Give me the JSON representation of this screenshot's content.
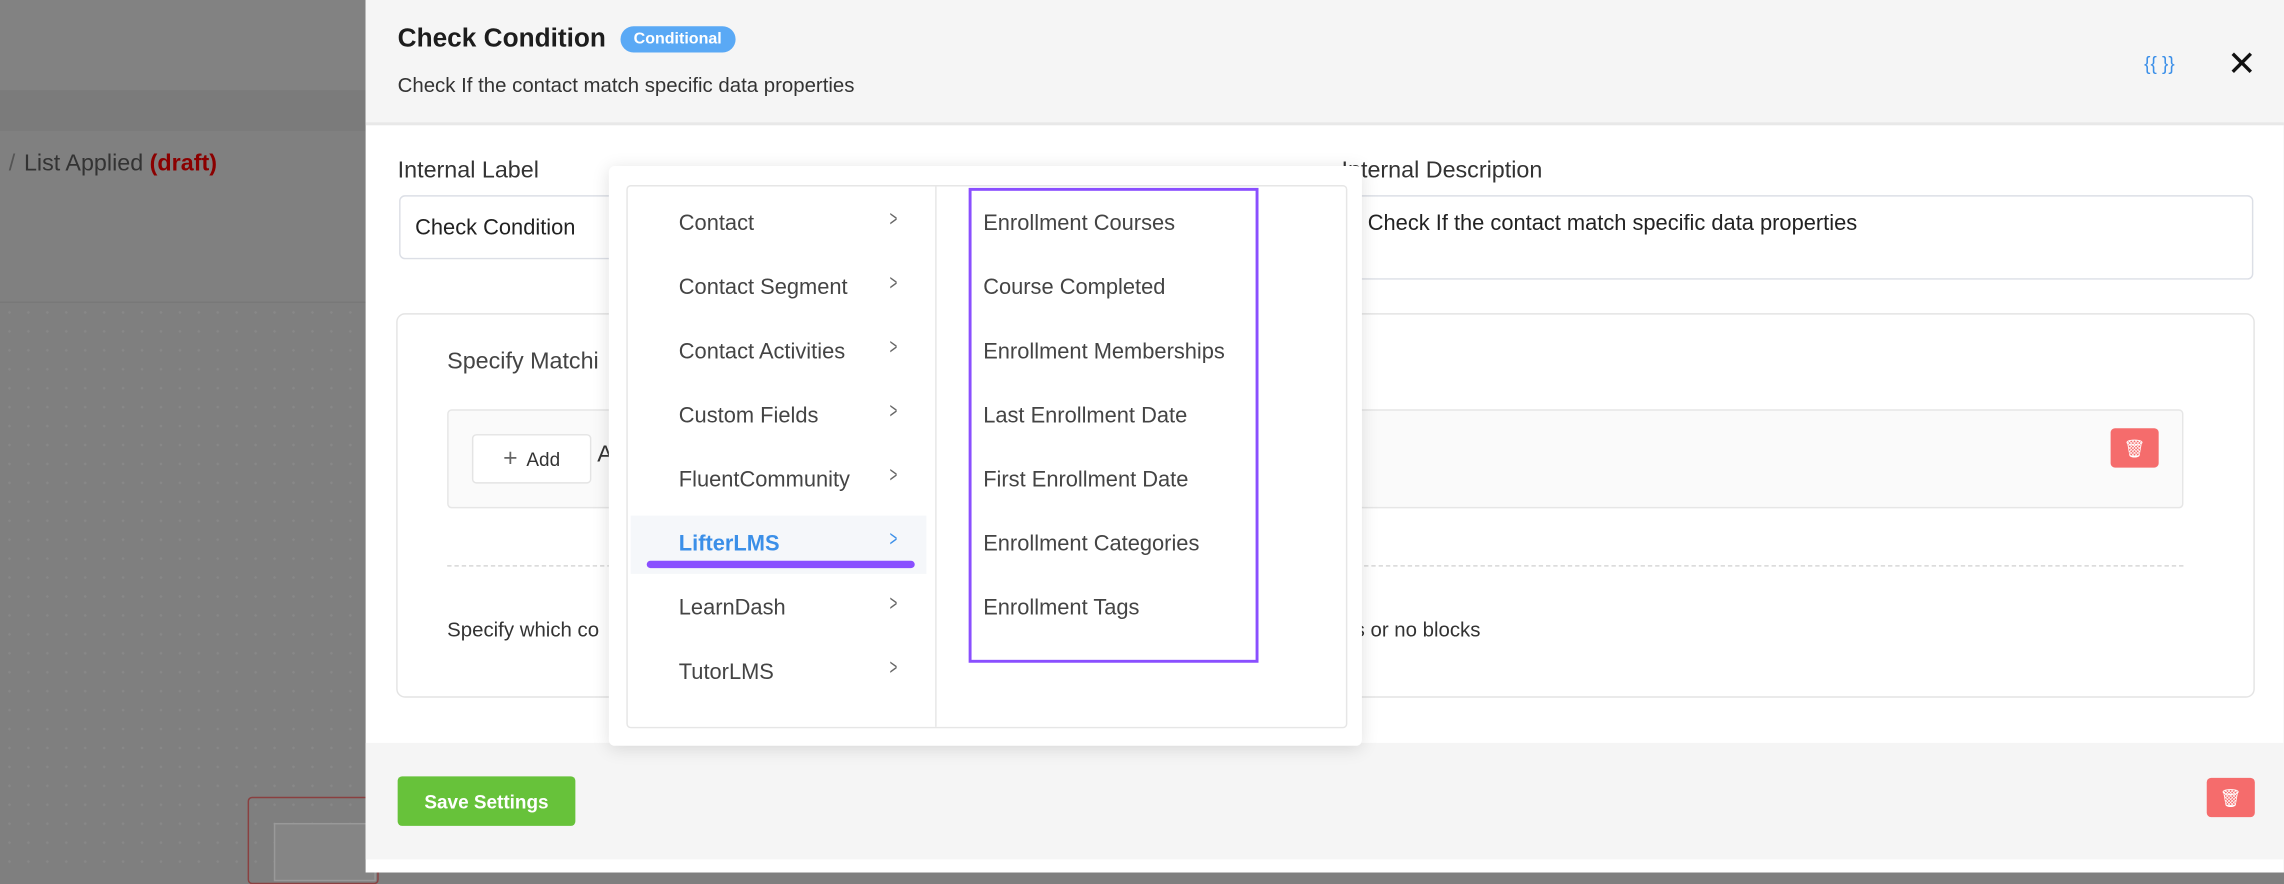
{
  "background": {
    "breadcrumb_sep": "/",
    "breadcrumb_page": "List Applied",
    "breadcrumb_status": "(draft)"
  },
  "header": {
    "title": "Check Condition",
    "badge": "Conditional",
    "subtitle": "Check If the contact match specific data properties",
    "smartcode_icon": "{{ }}",
    "close_icon": "✕"
  },
  "form": {
    "internal_label": "Internal Label",
    "internal_label_value": "Check Condition",
    "internal_description": "Internal Description",
    "internal_description_value": "Check If the contact match specific data properties"
  },
  "card": {
    "title_visible": "Specify Matchi",
    "add_label": "Add",
    "add_after": "A",
    "note_left": "Specify which co",
    "note_right": "ks or no blocks"
  },
  "footer": {
    "save_label": "Save Settings"
  },
  "dropdown": {
    "categories": [
      {
        "label": "Contact"
      },
      {
        "label": "Contact Segment"
      },
      {
        "label": "Contact Activities"
      },
      {
        "label": "Custom Fields"
      },
      {
        "label": "FluentCommunity"
      },
      {
        "label": "LifterLMS",
        "active": true
      },
      {
        "label": "LearnDash"
      },
      {
        "label": "TutorLMS"
      }
    ],
    "options": [
      "Enrollment Courses",
      "Course Completed",
      "Enrollment Memberships",
      "Last Enrollment Date",
      "First Enrollment Date",
      "Enrollment Categories",
      "Enrollment Tags"
    ]
  },
  "colors": {
    "accent": "#3b8fe8",
    "badge": "#5aa9f5",
    "save": "#67c23a",
    "danger": "#f56c6c",
    "highlight": "#8a4fff"
  }
}
